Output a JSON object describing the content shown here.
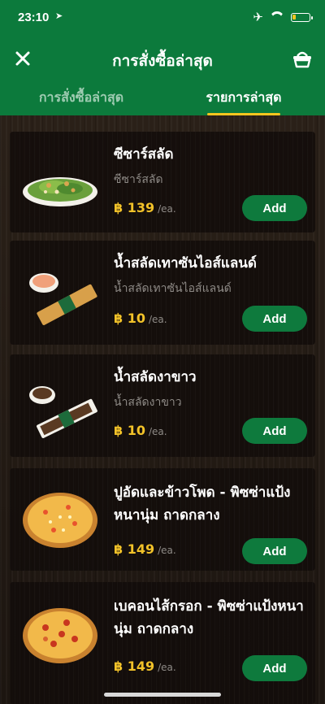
{
  "status": {
    "time": "23:10"
  },
  "header": {
    "title": "การสั่งซื้อล่าสุด",
    "close_icon": "close-icon",
    "basket_icon": "basket-icon"
  },
  "tabs": [
    {
      "label": "การสั่งซื้อล่าสุด",
      "active": false
    },
    {
      "label": "รายการล่าสุด",
      "active": true
    }
  ],
  "items": [
    {
      "name": "ซีซาร์สลัด",
      "subname": "ซีซาร์สลัด",
      "price": "฿ 139",
      "unit": "/ea.",
      "add": "Add"
    },
    {
      "name": "น้ำสลัดเทาซันไอส์แลนด์",
      "subname": "น้ำสลัดเทาซันไอส์แลนด์",
      "price": "฿ 10",
      "unit": "/ea.",
      "add": "Add"
    },
    {
      "name": "น้ำสลัดงาขาว",
      "subname": "น้ำสลัดงาขาว",
      "price": "฿ 10",
      "unit": "/ea.",
      "add": "Add"
    },
    {
      "name": "ปูอัดและข้าวโพด - พิซซ่าแป้งหนานุ่ม ถาดกลาง",
      "subname": "",
      "price": "฿ 149",
      "unit": "/ea.",
      "add": "Add"
    },
    {
      "name": "เบคอนไส้กรอก - พิซซ่าแป้งหนานุ่ม ถาดกลาง",
      "subname": "",
      "price": "฿ 149",
      "unit": "/ea.",
      "add": "Add"
    }
  ],
  "colors": {
    "brand_green": "#0c7a3c",
    "price_gold": "#f2c229",
    "tab_indicator": "#f4c51f"
  }
}
